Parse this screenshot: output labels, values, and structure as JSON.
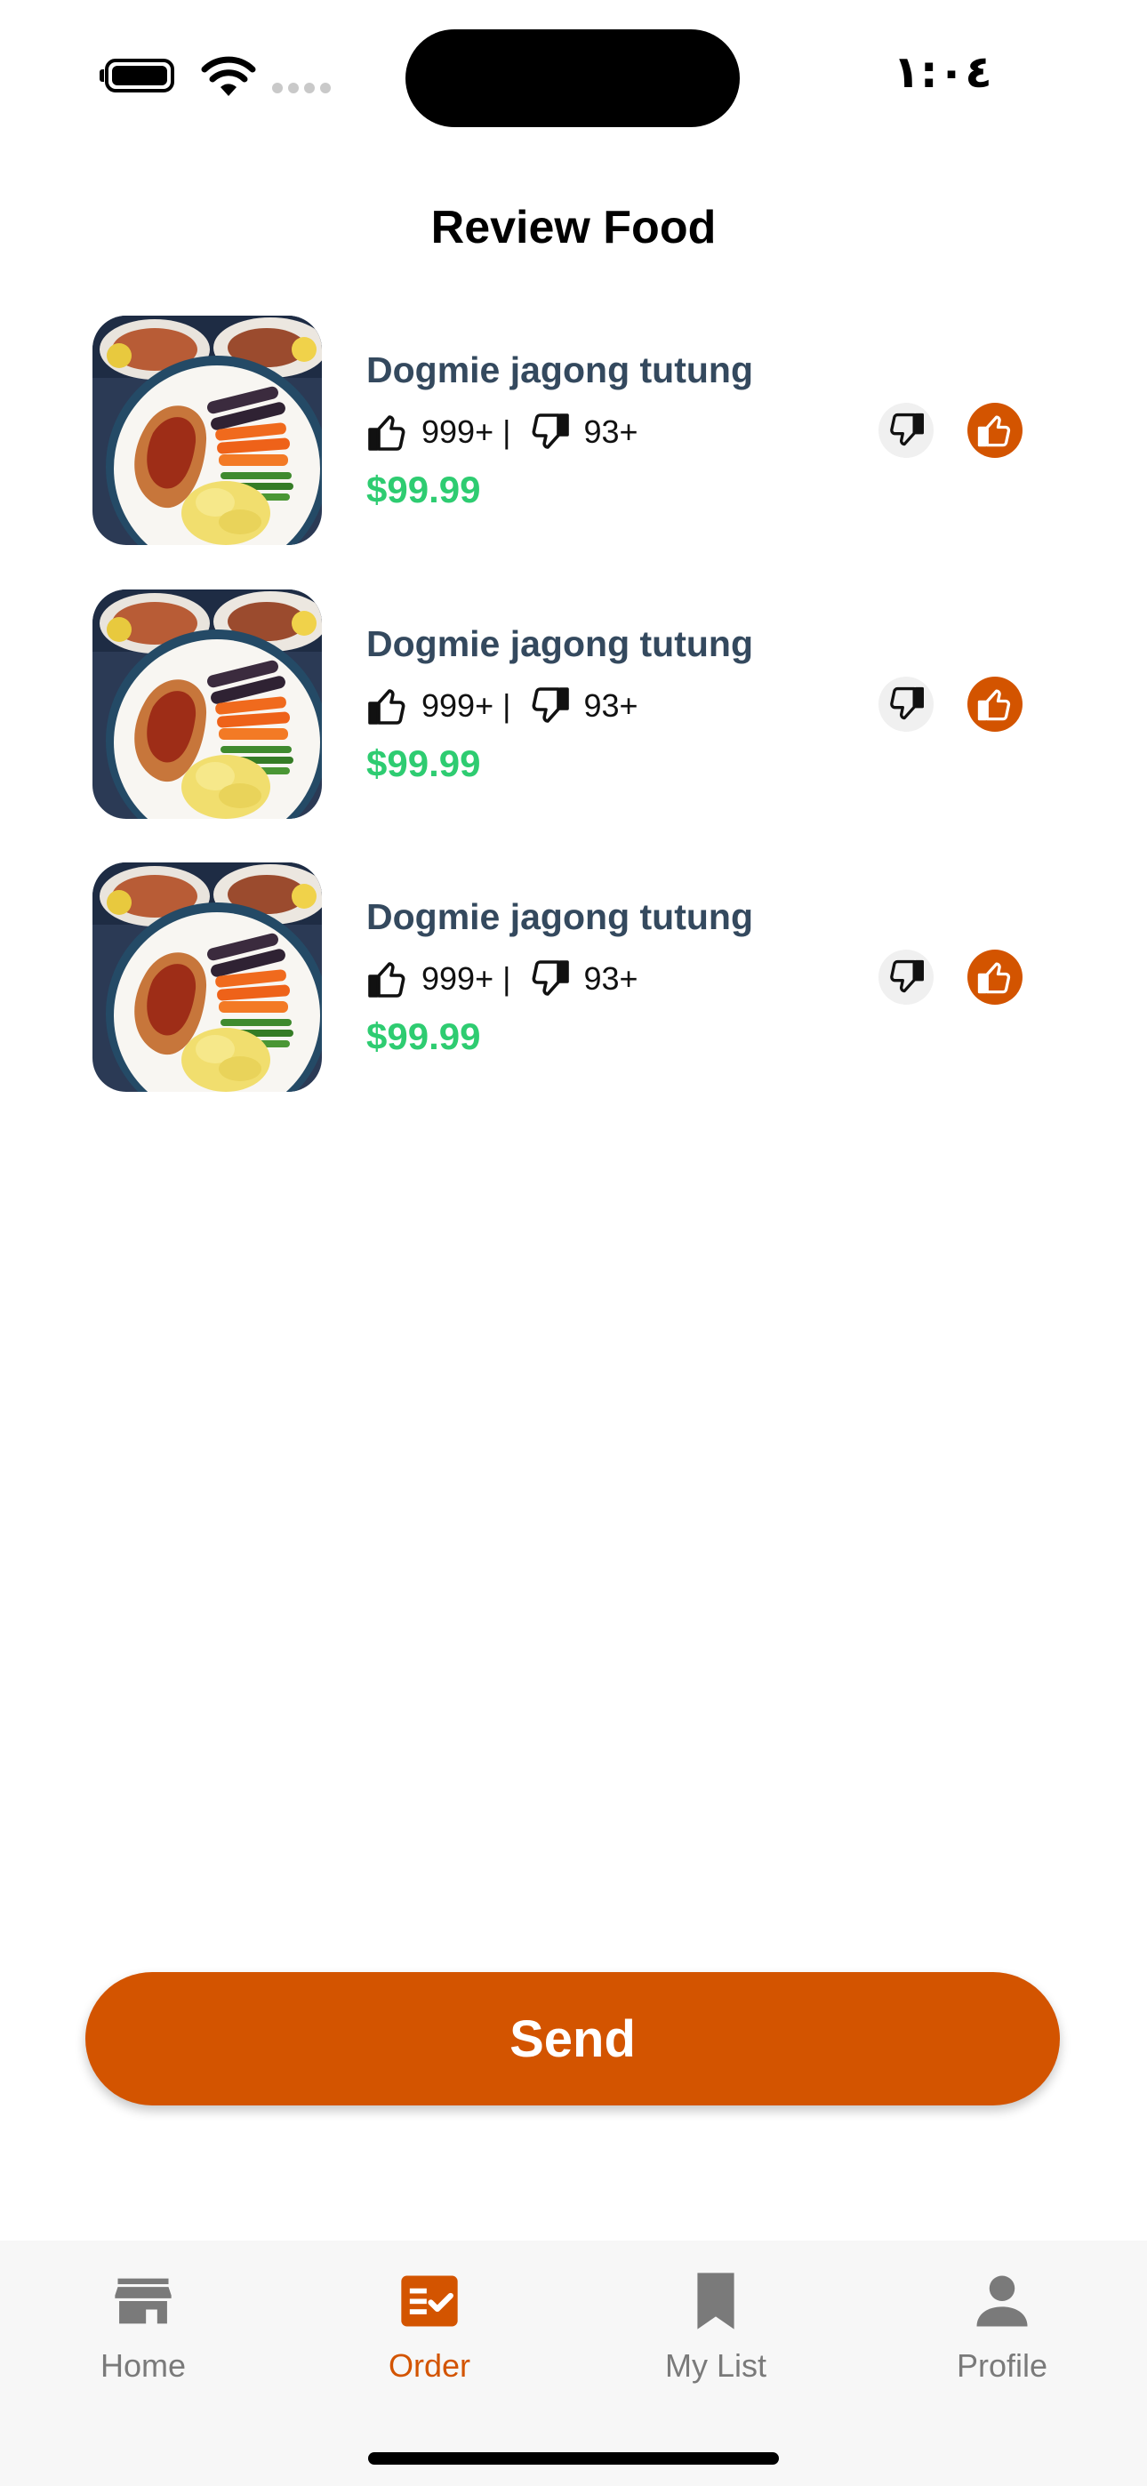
{
  "status_bar": {
    "time": "١:٠٤"
  },
  "header": {
    "title": "Review Food"
  },
  "items": [
    {
      "name": "Dogmie jagong tutung",
      "likes": "999+",
      "separator": "|",
      "dislikes": "93+",
      "price": "$99.99"
    },
    {
      "name": "Dogmie jagong tutung",
      "likes": "999+",
      "separator": "|",
      "dislikes": "93+",
      "price": "$99.99"
    },
    {
      "name": "Dogmie jagong tutung",
      "likes": "999+",
      "separator": "|",
      "dislikes": "93+",
      "price": "$99.99"
    }
  ],
  "actions": {
    "send_label": "Send"
  },
  "nav": [
    {
      "label": "Home",
      "icon": "store-icon"
    },
    {
      "label": "Order",
      "icon": "order-list-icon",
      "active": true
    },
    {
      "label": "My List",
      "icon": "bookmark-icon"
    },
    {
      "label": "Profile",
      "icon": "person-icon"
    }
  ],
  "colors": {
    "accent": "#d35400",
    "price": "#2ecc71",
    "item_title": "#34495e",
    "nav_inactive": "#7a7a7a"
  }
}
